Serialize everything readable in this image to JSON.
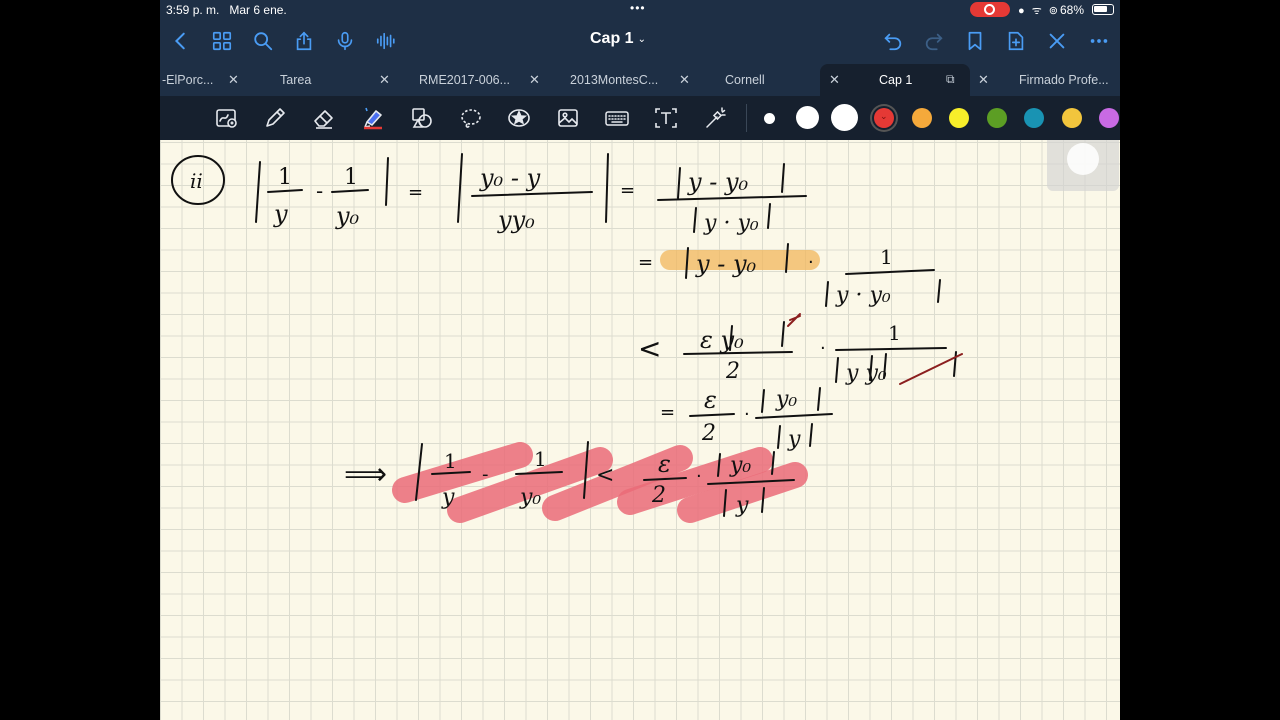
{
  "status_bar": {
    "time": "3:59 p. m.",
    "date": "Mar 6 ene.",
    "battery": "68%"
  },
  "nav_bar": {
    "title": "Cap 1",
    "accent_color": "#4a9cf4"
  },
  "tabs": [
    {
      "label": "-ElPorc..."
    },
    {
      "label": "Tarea"
    },
    {
      "label": "RME2017-006..."
    },
    {
      "label": "2013MontesC..."
    },
    {
      "label": "Cornell"
    },
    {
      "label": "Cap 1",
      "active": true
    },
    {
      "label": "Firmado Profe..."
    }
  ],
  "palette": [
    "#ffffff",
    "#ffffff",
    "#ffffff",
    "#e53935",
    "#f5a93b",
    "#f7ee2a",
    "#5c9e24",
    "#1993b3",
    "#f2c53d",
    "#c86ae4"
  ],
  "colors": {
    "page_background": "#fbf8e8",
    "ink": "#111111",
    "highlight_orange": "#f2b75c",
    "highlight_red": "#ea6b78"
  },
  "math": {
    "item_label": "ii",
    "one": "1",
    "var_y": "y",
    "var_y0": "y₀",
    "ineq_lt": "<",
    "eq": "=",
    "implies": "⟹",
    "epsilon": "ε",
    "two": "2",
    "dot": "·",
    "minus": "-"
  }
}
